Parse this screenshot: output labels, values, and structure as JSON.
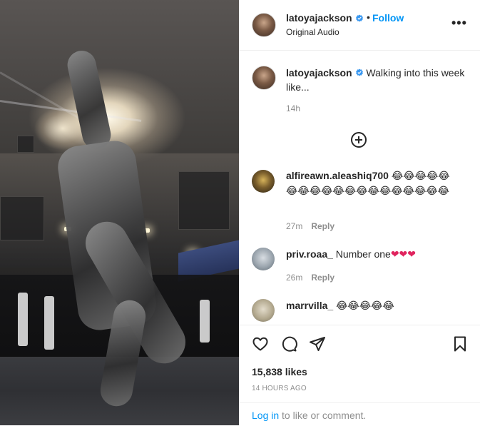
{
  "post": {
    "author": {
      "username": "latoyajackson",
      "audio": "Original Audio",
      "follow_label": "Follow",
      "separator": "•"
    },
    "caption": {
      "username": "latoyajackson",
      "text": "Walking into this week like...",
      "time": "14h"
    },
    "comments": [
      {
        "username": "alfireawn.aleashiq700",
        "text": "😂😂😂😂😂😂😂😂😂😂😂😂😂😂😂😂😂😂😂",
        "time": "27m",
        "reply_label": "Reply"
      },
      {
        "username": "priv.roaa_",
        "text": "Number one",
        "hearts": "❤❤❤",
        "time": "26m",
        "reply_label": "Reply"
      },
      {
        "username": "marrvilla_",
        "text": "😂😂😂😂😂"
      }
    ],
    "likes": "15,838 likes",
    "posted_time": "14 HOURS AGO",
    "footer": {
      "login_label": "Log in",
      "rest": " to like or comment."
    }
  },
  "icons": {
    "more": "more-options-icon",
    "heart": "heart-icon",
    "comment": "comment-icon",
    "share": "share-icon",
    "save": "bookmark-icon",
    "load_more": "plus-circle-icon",
    "verified": "verified-badge-icon"
  },
  "colors": {
    "link_blue": "#0095f6",
    "verified_blue": "#3897f0",
    "muted": "#8e8e8e",
    "heart_red": "#e0245e"
  }
}
